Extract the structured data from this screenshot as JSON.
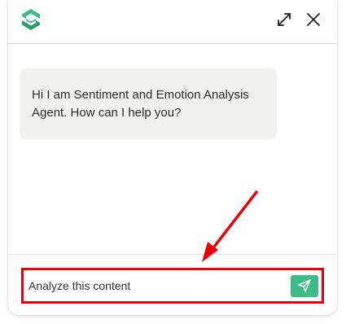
{
  "header": {
    "logo_icon": "hexagon-logo-icon",
    "expand_icon": "expand-arrows-icon",
    "close_icon": "close-icon"
  },
  "messages": [
    {
      "role": "agent",
      "text": "Hi I am Sentiment and Emotion Analysis Agent. How can I help you?"
    }
  ],
  "composer": {
    "input_value": "Analyze this content",
    "send_icon": "send-paper-plane-icon"
  },
  "colors": {
    "brand_green": "#3dbd86",
    "annotation_red": "#e8000b",
    "bubble_background": "#f1f1ef"
  }
}
